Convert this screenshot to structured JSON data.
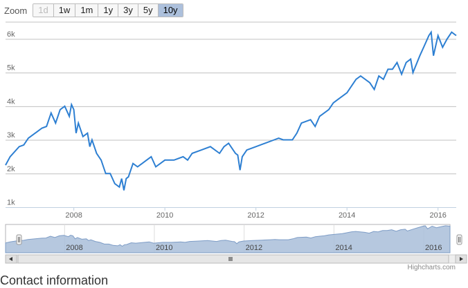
{
  "zoom": {
    "label": "Zoom",
    "buttons": [
      {
        "label": "1d",
        "state": "disabled"
      },
      {
        "label": "1w",
        "state": "normal"
      },
      {
        "label": "1m",
        "state": "normal"
      },
      {
        "label": "1y",
        "state": "normal"
      },
      {
        "label": "3y",
        "state": "normal"
      },
      {
        "label": "5y",
        "state": "normal"
      },
      {
        "label": "10y",
        "state": "selected"
      }
    ]
  },
  "credits": "Highcharts.com",
  "next_section_heading": "Contact information",
  "colors": {
    "line": "#2d7fd2",
    "navigator_fill": "#a9bed9",
    "navigator_line": "#7d9cc6",
    "grid": "#c0c0c0",
    "selected_button": "#acc0dc"
  },
  "chart_data": {
    "type": "line",
    "title": "",
    "xlabel": "",
    "ylabel": "",
    "ylim": [
      1000,
      6500
    ],
    "xlim": [
      2006.5,
      2016.4
    ],
    "y_ticks": [
      1000,
      2000,
      3000,
      4000,
      5000,
      6000
    ],
    "y_tick_labels": [
      "1k",
      "2k",
      "3k",
      "4k",
      "5k",
      "6k"
    ],
    "x_ticks": [
      2008,
      2010,
      2012,
      2014,
      2016
    ],
    "x_tick_labels": [
      "2008",
      "2010",
      "2012",
      "2014",
      "2016"
    ],
    "navigator_labels": [
      "2008",
      "2010",
      "2012",
      "2014",
      "2016"
    ],
    "grid": true,
    "series": [
      {
        "x": [
          2006.5,
          2006.6,
          2006.8,
          2006.9,
          2007.0,
          2007.1,
          2007.2,
          2007.3,
          2007.4,
          2007.5,
          2007.6,
          2007.7,
          2007.8,
          2007.9,
          2007.95,
          2008.0,
          2008.05,
          2008.1,
          2008.2,
          2008.3,
          2008.35,
          2008.4,
          2008.5,
          2008.6,
          2008.7,
          2008.8,
          2008.9,
          2009.0,
          2009.05,
          2009.1,
          2009.15,
          2009.2,
          2009.3,
          2009.4,
          2009.5,
          2009.6,
          2009.7,
          2009.8,
          2009.9,
          2010.0,
          2010.2,
          2010.4,
          2010.5,
          2010.6,
          2010.8,
          2011.0,
          2011.2,
          2011.3,
          2011.4,
          2011.55,
          2011.6,
          2011.65,
          2011.7,
          2011.8,
          2012.0,
          2012.2,
          2012.4,
          2012.5,
          2012.6,
          2012.8,
          2012.9,
          2013.0,
          2013.2,
          2013.3,
          2013.4,
          2013.5,
          2013.6,
          2013.7,
          2013.8,
          2014.0,
          2014.2,
          2014.3,
          2014.5,
          2014.6,
          2014.7,
          2014.8,
          2014.9,
          2015.0,
          2015.1,
          2015.2,
          2015.3,
          2015.4,
          2015.45,
          2015.6,
          2015.7,
          2015.8,
          2015.85,
          2015.9,
          2016.0,
          2016.1,
          2016.2,
          2016.3,
          2016.4
        ],
        "y": [
          2250,
          2500,
          2800,
          2850,
          3050,
          3150,
          3250,
          3350,
          3400,
          3800,
          3500,
          3900,
          4000,
          3700,
          4050,
          3900,
          3200,
          3500,
          3100,
          3200,
          2800,
          3000,
          2600,
          2400,
          2000,
          2000,
          1700,
          1600,
          1850,
          1500,
          1850,
          1900,
          2300,
          2200,
          2300,
          2400,
          2500,
          2200,
          2300,
          2400,
          2400,
          2500,
          2400,
          2600,
          2700,
          2800,
          2600,
          2800,
          2900,
          2600,
          2550,
          2100,
          2500,
          2700,
          2800,
          2900,
          3000,
          3050,
          3000,
          3000,
          3200,
          3500,
          3600,
          3400,
          3700,
          3800,
          3900,
          4100,
          4200,
          4400,
          4800,
          4900,
          4700,
          4500,
          4900,
          4800,
          5100,
          5100,
          5300,
          4950,
          5300,
          5400,
          5000,
          5500,
          5800,
          6100,
          6200,
          5500,
          6100,
          5750,
          6000,
          6200,
          6100
        ]
      }
    ]
  }
}
